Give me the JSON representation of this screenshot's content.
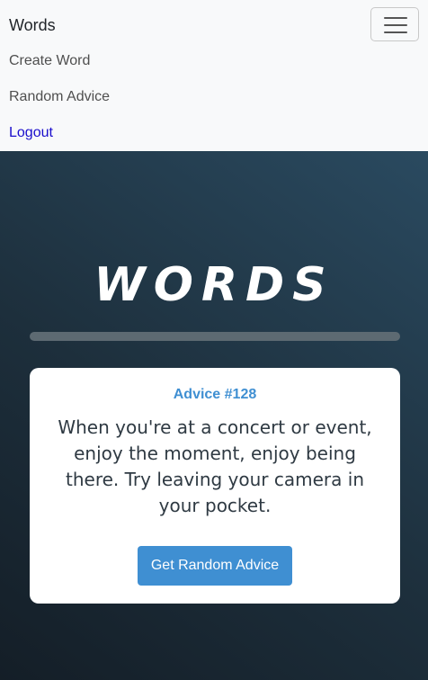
{
  "navbar": {
    "brand": "Words",
    "links": {
      "create_word": "Create Word",
      "random_advice": "Random Advice",
      "logout": "Logout"
    },
    "toggler_icon": "hamburger-menu-icon"
  },
  "hero": {
    "title": "WORDS"
  },
  "advice_card": {
    "id_label": "Advice #128",
    "text": "When you're at a concert or event, enjoy the moment, enjoy being there. Try leaving your camera in your pocket.",
    "button_label": "Get Random Advice"
  },
  "colors": {
    "accent": "#3f8fd2",
    "link_logout": "#1a0dcc",
    "navbar_bg": "#f8f9fa",
    "hero_bg_dark": "#141e27",
    "hero_bg_light": "#2a4a60"
  }
}
